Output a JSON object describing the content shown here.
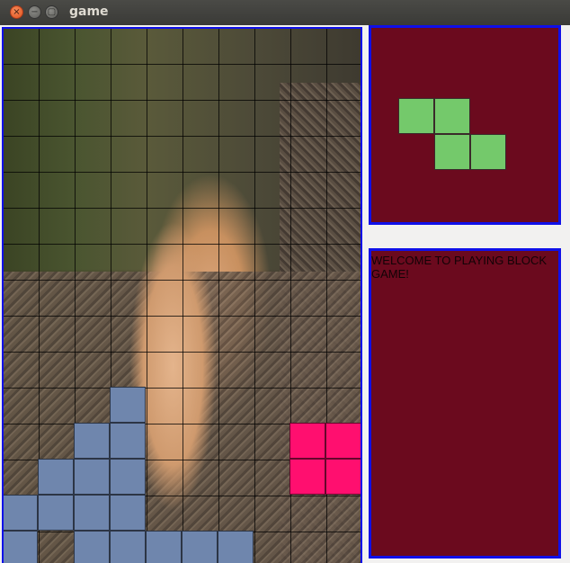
{
  "window": {
    "title": "game",
    "close_symbol": "×",
    "minimize_symbol": "−",
    "maximize_symbol": "▢"
  },
  "colors": {
    "stack_block": "#6f86ad",
    "falling_block": "#ff0f6f",
    "next_block": "#74c96b",
    "panel_bg": "#6b0a1e",
    "panel_border": "#1010e8"
  },
  "board": {
    "cols": 10,
    "rows": 15,
    "background": "photo",
    "stack_cells": [
      [
        3,
        10
      ],
      [
        2,
        11
      ],
      [
        3,
        11
      ],
      [
        1,
        12
      ],
      [
        2,
        12
      ],
      [
        3,
        12
      ],
      [
        0,
        13
      ],
      [
        1,
        13
      ],
      [
        2,
        13
      ],
      [
        3,
        13
      ],
      [
        0,
        14
      ],
      [
        2,
        14
      ],
      [
        3,
        14
      ],
      [
        4,
        14
      ],
      [
        5,
        14
      ],
      [
        6,
        14
      ]
    ],
    "falling_cells": [
      [
        8,
        11
      ],
      [
        9,
        11
      ],
      [
        8,
        12
      ],
      [
        9,
        12
      ]
    ]
  },
  "next_piece": {
    "cells": [
      [
        0,
        0
      ],
      [
        1,
        0
      ],
      [
        1,
        1
      ],
      [
        2,
        1
      ]
    ]
  },
  "message": {
    "text": "WELCOME TO PLAYING BLOCK GAME!"
  }
}
